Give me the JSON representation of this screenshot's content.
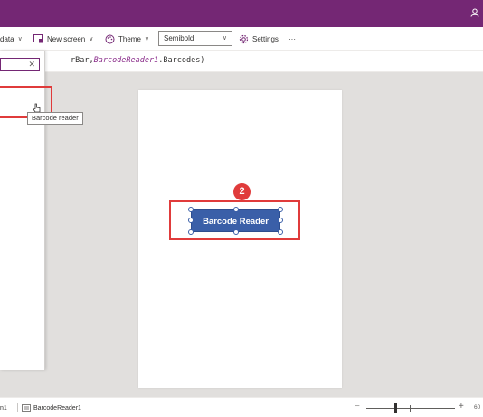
{
  "toolbar": {
    "data_label": "data",
    "new_screen_label": "New screen",
    "theme_label": "Theme",
    "font_weight_value": "Semibold",
    "settings_label": "Settings",
    "more_label": "···"
  },
  "formula": {
    "prefix": "rBar,",
    "highlight": "BarcodeReader1",
    "suffix": ".Barcodes)"
  },
  "insert_panel": {
    "search_clear": "✕"
  },
  "tooltip": "Barcode reader",
  "canvas": {
    "step_badge": "2",
    "button_label": "Barcode Reader"
  },
  "statusbar": {
    "screen_label": "n1",
    "selected_control": "BarcodeReader1",
    "zoom_minus": "−",
    "zoom_plus": "+",
    "zoom_value": "60"
  },
  "colors": {
    "brand": "#742774",
    "button": "#3a5fa8",
    "annotation": "#e03b3b"
  },
  "icons": {
    "user": "user-icon",
    "data": "database-icon",
    "new_screen": "new-screen-icon",
    "theme": "palette-icon",
    "settings": "gear-icon",
    "control": "control-icon"
  }
}
